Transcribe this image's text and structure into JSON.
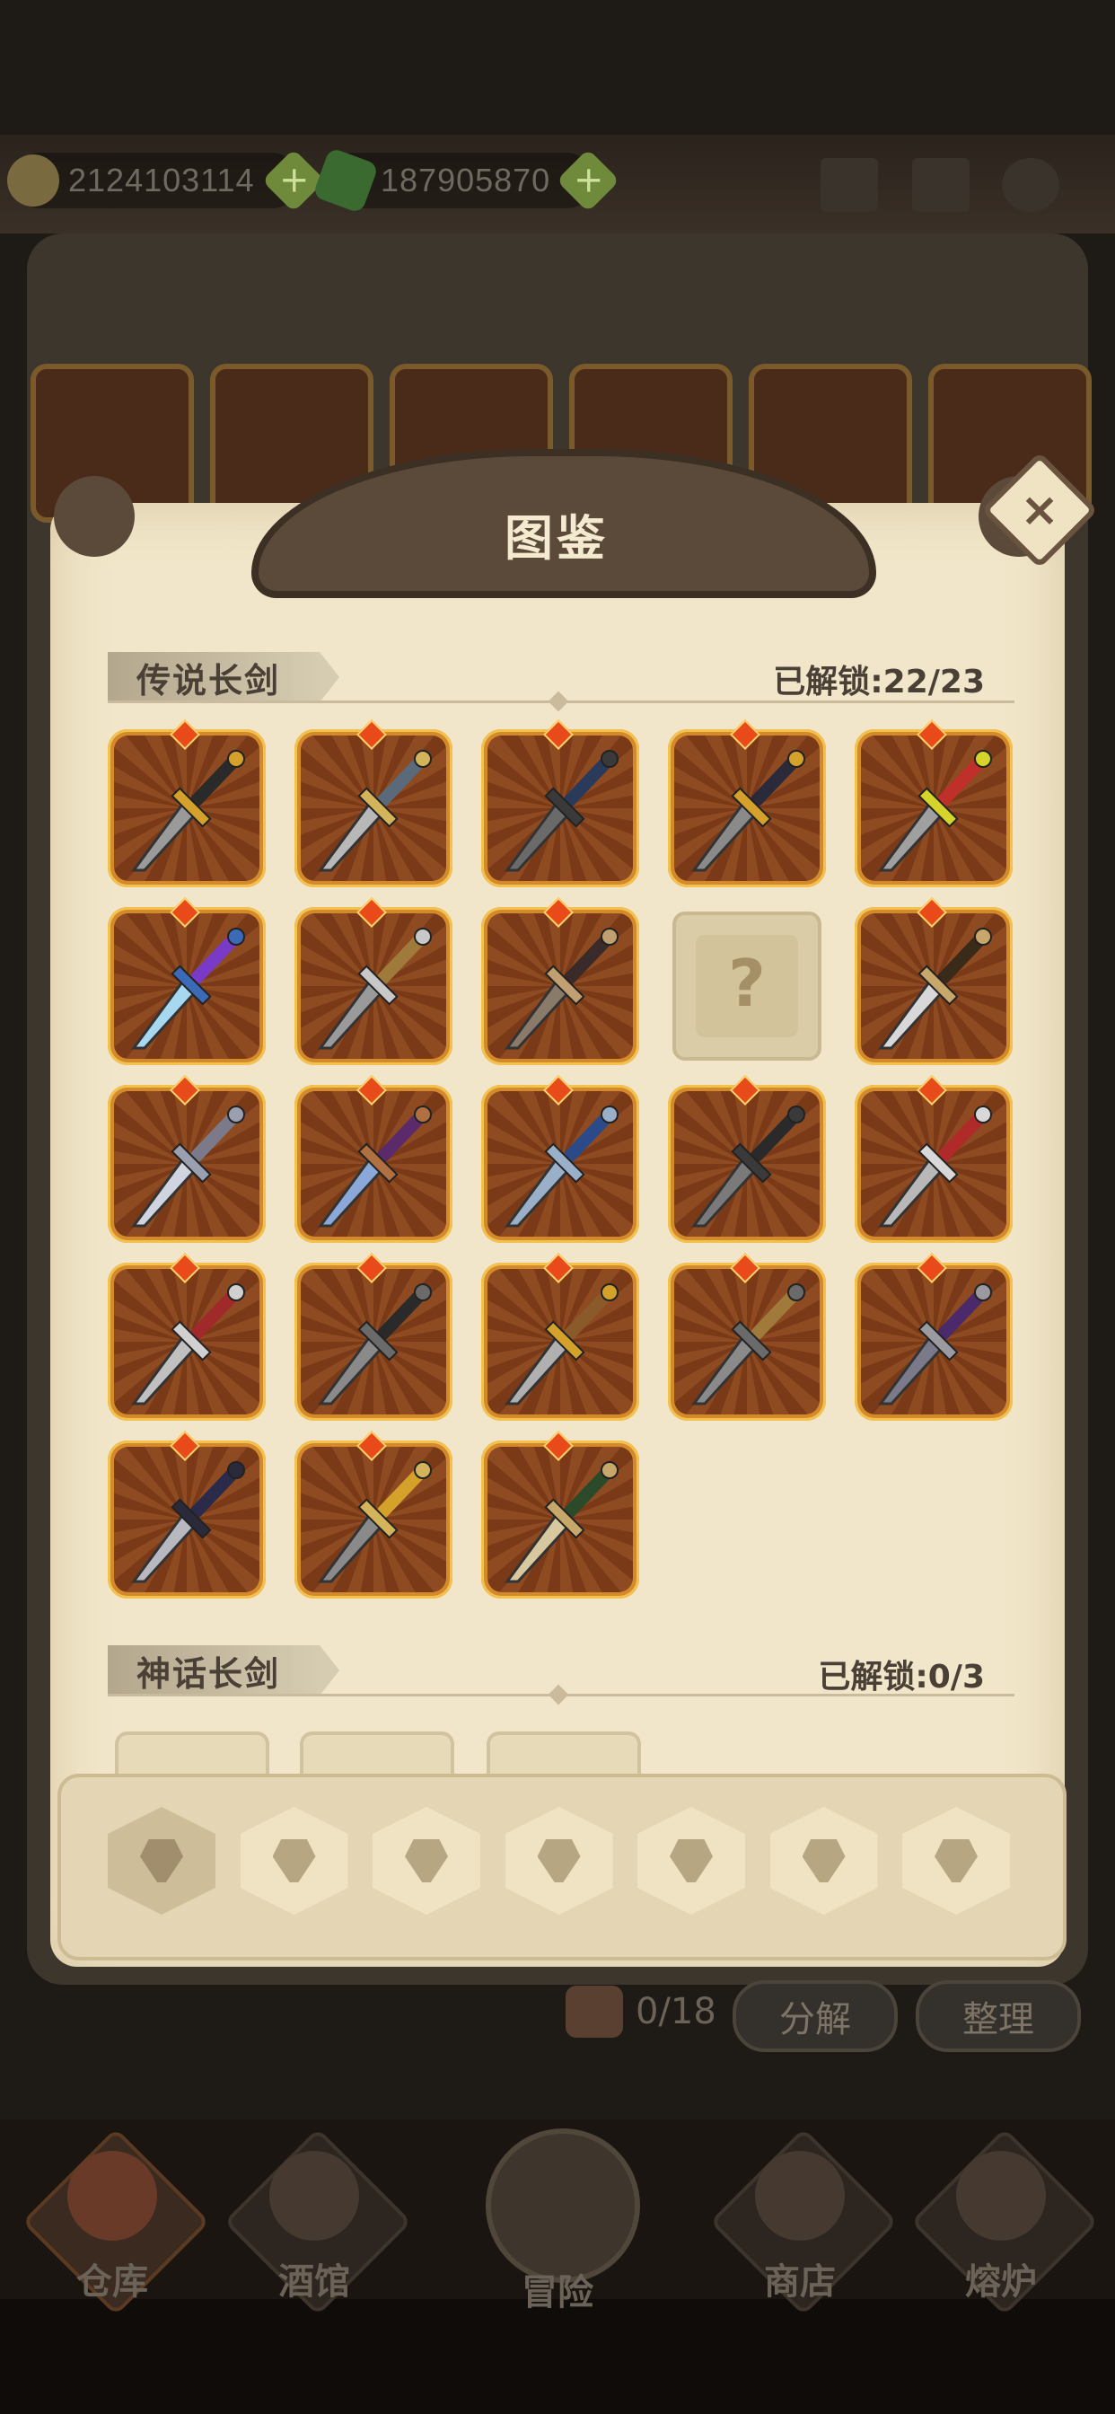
{
  "resources": {
    "coins": "2124103114",
    "gems": "187905870"
  },
  "top_icons": [
    "mail-icon",
    "book-icon",
    "gear-icon"
  ],
  "codex": {
    "title": "图鉴",
    "sections": [
      {
        "name": "传说长剑",
        "unlocked_label": "已解锁:22/23",
        "items": [
          {
            "state": "unlocked",
            "blade": "#9a9a9a",
            "hilt": "#d4a22a",
            "grip": "#2a2a2a"
          },
          {
            "state": "unlocked",
            "blade": "#b8b8b8",
            "hilt": "#d4b45a",
            "grip": "#5a6a7a"
          },
          {
            "state": "unlocked",
            "blade": "#6a6a6a",
            "hilt": "#3a3a3a",
            "grip": "#2a3a5a"
          },
          {
            "state": "unlocked",
            "blade": "#8a8a8a",
            "hilt": "#d4a22a",
            "grip": "#2a2a3a"
          },
          {
            "state": "unlocked",
            "blade": "#a0a0a0",
            "hilt": "#d4d42a",
            "grip": "#c0302a"
          },
          {
            "state": "unlocked",
            "blade": "#a8d8f0",
            "hilt": "#3a6ab8",
            "grip": "#7a3ac8"
          },
          {
            "state": "unlocked",
            "blade": "#9a9a9a",
            "hilt": "#c8c8c8",
            "grip": "#a07a3a"
          },
          {
            "state": "unlocked",
            "blade": "#8a7a6a",
            "hilt": "#c0a070",
            "grip": "#3a2a2a"
          },
          {
            "state": "locked",
            "mark": "?"
          },
          {
            "state": "unlocked",
            "blade": "#d8d8d8",
            "hilt": "#c8a86a",
            "grip": "#3a2a1a"
          },
          {
            "state": "unlocked",
            "blade": "#d0d4e0",
            "hilt": "#9aa0b0",
            "grip": "#7a7a8a"
          },
          {
            "state": "unlocked",
            "blade": "#8aa8d8",
            "hilt": "#b07040",
            "grip": "#5a2a6a"
          },
          {
            "state": "unlocked",
            "blade": "#9ab0c8",
            "hilt": "#9ab0c8",
            "grip": "#2a4a8a"
          },
          {
            "state": "unlocked",
            "blade": "#7a7a7a",
            "hilt": "#3a3a3a",
            "grip": "#2a2a2a"
          },
          {
            "state": "unlocked",
            "blade": "#b8b8b8",
            "hilt": "#d8d8d8",
            "grip": "#b02a2a"
          },
          {
            "state": "unlocked",
            "blade": "#c0c0c0",
            "hilt": "#d0d0d0",
            "grip": "#a02a2a"
          },
          {
            "state": "unlocked",
            "blade": "#8a8a8a",
            "hilt": "#6a6a6a",
            "grip": "#2a2a2a"
          },
          {
            "state": "unlocked",
            "blade": "#b0b0b0",
            "hilt": "#d4a22a",
            "grip": "#8a5a2a"
          },
          {
            "state": "unlocked",
            "blade": "#8a8a8a",
            "hilt": "#6a6a6a",
            "grip": "#a07a3a"
          },
          {
            "state": "unlocked",
            "blade": "#7a7a8a",
            "hilt": "#9a9aa0",
            "grip": "#4a2a6a"
          },
          {
            "state": "unlocked",
            "blade": "#b8b8c0",
            "hilt": "#2a2a3a",
            "grip": "#2a2a4a"
          },
          {
            "state": "unlocked",
            "blade": "#8a8a8a",
            "hilt": "#d4b45a",
            "grip": "#d4a22a"
          },
          {
            "state": "unlocked",
            "blade": "#d8c8a0",
            "hilt": "#c8a86a",
            "grip": "#2a4a2a"
          }
        ]
      },
      {
        "name": "神话长剑",
        "unlocked_label": "已解锁:0/3"
      }
    ],
    "tabs": [
      "dagger-icon",
      "club-icon",
      "sword-icon",
      "shield-icon",
      "book-icon",
      "helmet-icon",
      "ring-icon"
    ]
  },
  "inventory": {
    "bag_count": "0/18",
    "decompose": "分解",
    "sort": "整理"
  },
  "nav": [
    "仓库",
    "酒馆",
    "冒险",
    "商店",
    "熔炉"
  ]
}
